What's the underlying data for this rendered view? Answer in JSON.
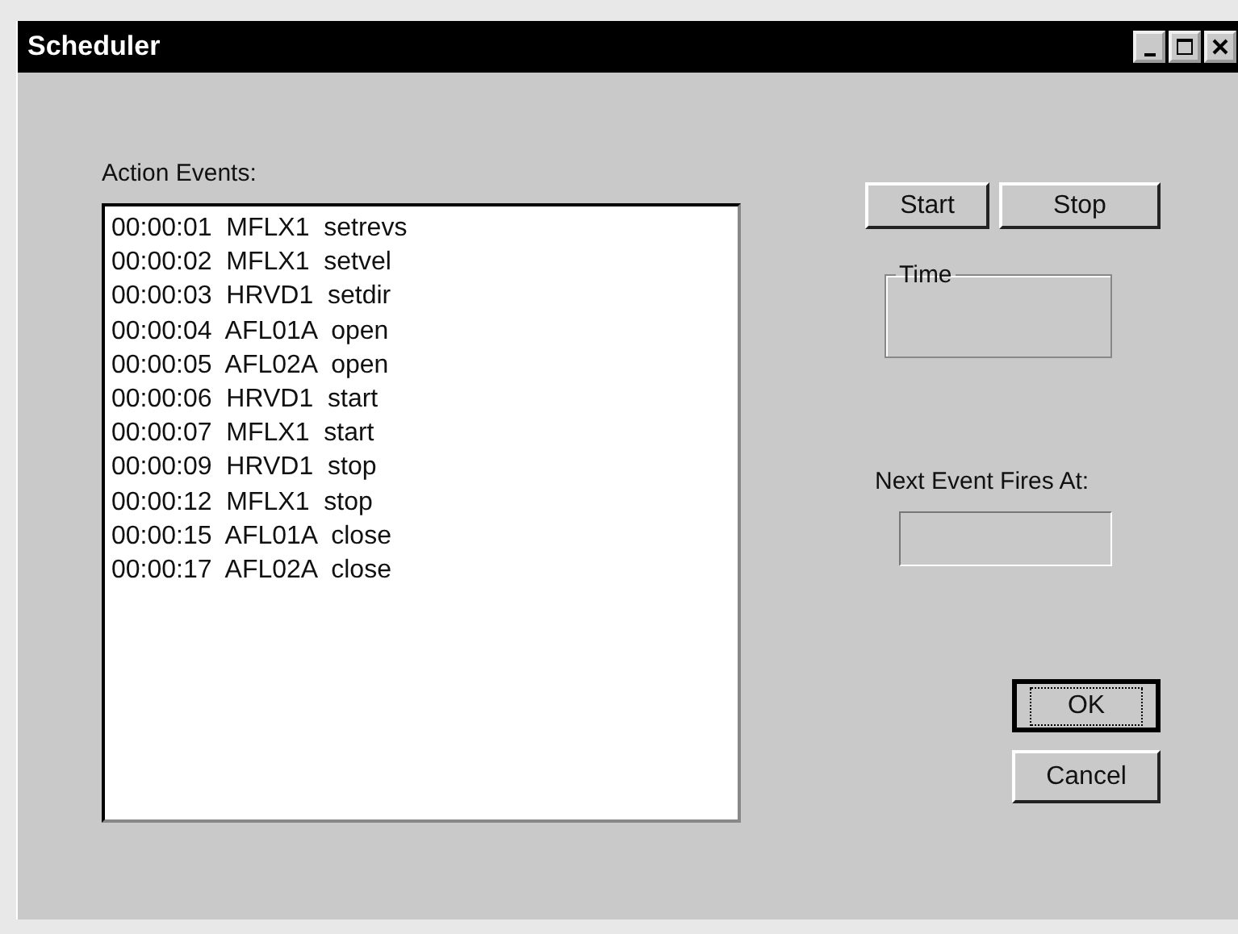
{
  "window": {
    "title": "Scheduler"
  },
  "action_events": {
    "label": "Action Events:",
    "rows": [
      {
        "time": "00:00:01",
        "device": "MFLX1",
        "action": "setrevs"
      },
      {
        "time": "00:00:02",
        "device": "MFLX1",
        "action": "setvel"
      },
      {
        "time": "00:00:03",
        "device": "HRVD1",
        "action": "setdir"
      },
      {
        "time": "00:00:04",
        "device": "AFL01A",
        "action": "open"
      },
      {
        "time": "00:00:05",
        "device": "AFL02A",
        "action": "open"
      },
      {
        "time": "00:00:06",
        "device": "HRVD1",
        "action": "start"
      },
      {
        "time": "00:00:07",
        "device": "MFLX1",
        "action": "start"
      },
      {
        "time": "00:00:09",
        "device": "HRVD1",
        "action": "stop"
      },
      {
        "time": "00:00:12",
        "device": "MFLX1",
        "action": "stop"
      },
      {
        "time": "00:00:15",
        "device": "AFL01A",
        "action": "close"
      },
      {
        "time": "00:00:17",
        "device": "AFL02A",
        "action": "close"
      }
    ]
  },
  "control_buttons": [
    "Start",
    "Stop"
  ],
  "time_group": {
    "label": "Time"
  },
  "next_event": {
    "label": "Next Event Fires At:"
  },
  "dialog_buttons": [
    {
      "label": "OK",
      "focused": true
    },
    {
      "label": "Cancel",
      "focused": false
    }
  ]
}
